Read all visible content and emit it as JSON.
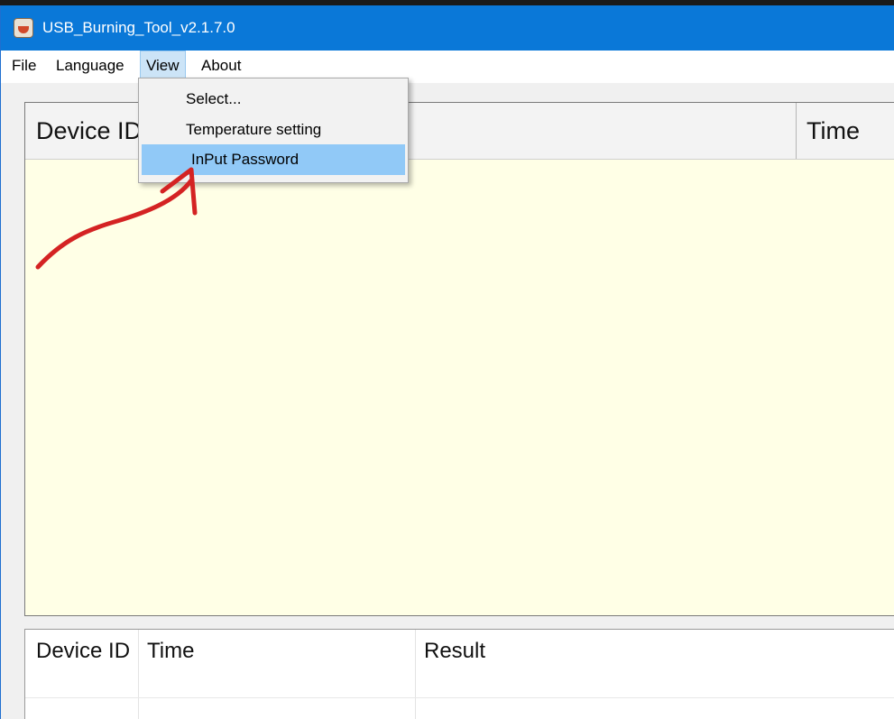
{
  "window": {
    "title": "USB_Burning_Tool_v2.1.7.0"
  },
  "menubar": {
    "items": [
      "File",
      "Language",
      "View",
      "About"
    ]
  },
  "view_menu": {
    "items": [
      "Select...",
      "Temperature setting",
      "InPut Password"
    ],
    "highlighted": "InPut Password"
  },
  "device_table": {
    "columns": [
      "Device ID",
      "Time"
    ]
  },
  "log_table": {
    "columns": [
      "Device ID",
      "Time",
      "Result"
    ]
  },
  "colors": {
    "titlebar": "#0a78d8",
    "menu_highlight": "#91c9f7",
    "panel": "#ffffe6",
    "annotation": "#d42323"
  },
  "icons": [
    "app-icon"
  ]
}
